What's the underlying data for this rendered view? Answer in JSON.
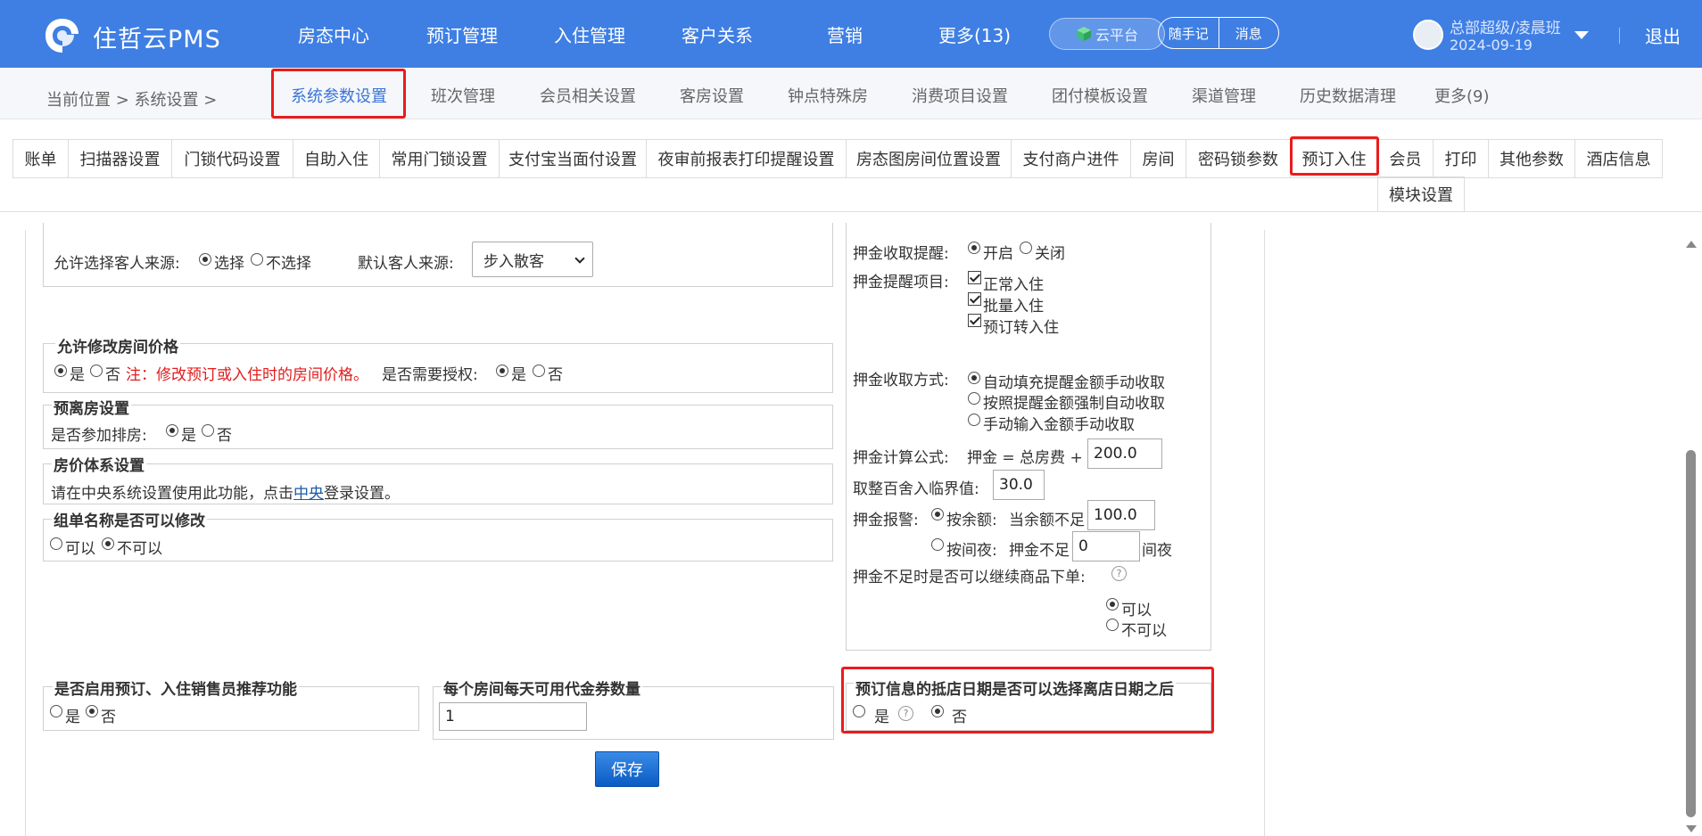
{
  "brand": {
    "name": "住哲云PMS"
  },
  "nav": {
    "items": [
      "房态中心",
      "预订管理",
      "入住管理",
      "客户关系",
      "营销",
      "更多(13)"
    ],
    "cloud": "云平台",
    "notes": "随手记",
    "messages": "消息"
  },
  "user": {
    "name": "总部超级/凌晨班",
    "date": "2024-09-19",
    "logout": "退出"
  },
  "breadcrumb": {
    "text": "当前位置 > 系统设置 >"
  },
  "category_tabs": [
    "系统参数设置",
    "班次管理",
    "会员相关设置",
    "客房设置",
    "钟点特殊房",
    "消费项目设置",
    "团付模板设置",
    "渠道管理",
    "历史数据清理",
    "更多(9)"
  ],
  "sub_tabs": [
    "账单",
    "扫描器设置",
    "门锁代码设置",
    "自助入住",
    "常用门锁设置",
    "支付宝当面付设置",
    "夜审前报表打印提醒设置",
    "房态图房间位置设置",
    "支付商户进件",
    "房间",
    "密码锁参数",
    "预订入住",
    "会员",
    "打印",
    "其他参数",
    "酒店信息"
  ],
  "sub_tab_row2": "模块设置",
  "guest_source": {
    "allow_label": "允许选择客人来源:",
    "opt_select": "选择",
    "opt_noselect": "不选择",
    "default_label": "默认客人来源:",
    "default_value": "步入散客"
  },
  "price_modify": {
    "legend": "允许修改房间价格",
    "yes": "是",
    "no": "否",
    "note": "注：修改预订或入住时的房间价格。",
    "auth_label": "是否需要授权:",
    "auth_yes": "是",
    "auth_no": "否"
  },
  "pre_departure": {
    "legend": "预离房设置",
    "label": "是否参加排房:",
    "yes": "是",
    "no": "否"
  },
  "price_system": {
    "legend": "房价体系设置",
    "text_before": "请在中央系统设置使用此功能，点击",
    "link": "中央",
    "text_after": "登录设置。"
  },
  "group_name": {
    "legend": "组单名称是否可以修改",
    "yes": "可以",
    "no": "不可以"
  },
  "deposit": {
    "remind_label": "押金收取提醒:",
    "remind_on": "开启",
    "remind_off": "关闭",
    "items_label": "押金提醒项目:",
    "items": [
      "正常入住",
      "批量入住",
      "预订转入住"
    ],
    "method_label": "押金收取方式:",
    "methods": [
      "自动填充提醒金额手动收取",
      "按照提醒金额强制自动收取",
      "手动输入金额手动收取"
    ],
    "formula_label": "押金计算公式:",
    "formula_text": "押金 = 总房费 +",
    "formula_value": "200.0",
    "rounding_label": "取整百舍入临界值:",
    "rounding_value": "30.0",
    "alarm_label": "押金报警:",
    "alarm_by_amount": "按余额:",
    "alarm_amount_text": "当余额不足",
    "alarm_amount_value": "100.0",
    "alarm_by_night": "按间夜:",
    "alarm_night_text": "押金不足",
    "alarm_night_value": "0",
    "alarm_night_unit": "间夜",
    "insufficient_label": "押金不足时是否可以继续商品下单:",
    "can": "可以",
    "cannot": "不可以"
  },
  "sales_recommend": {
    "legend": "是否启用预订、入住销售员推荐功能",
    "yes": "是",
    "no": "否"
  },
  "voucher": {
    "legend": "每个房间每天可用代金券数量",
    "value": "1"
  },
  "arrival_date": {
    "legend": "预订信息的抵店日期是否可以选择离店日期之后",
    "yes": "是",
    "no": "否"
  },
  "save_label": "保存",
  "colors": {
    "nav_bg": "#3f7fe4",
    "highlight": "#ea1c1c",
    "active_tab": "#3a74d9"
  }
}
